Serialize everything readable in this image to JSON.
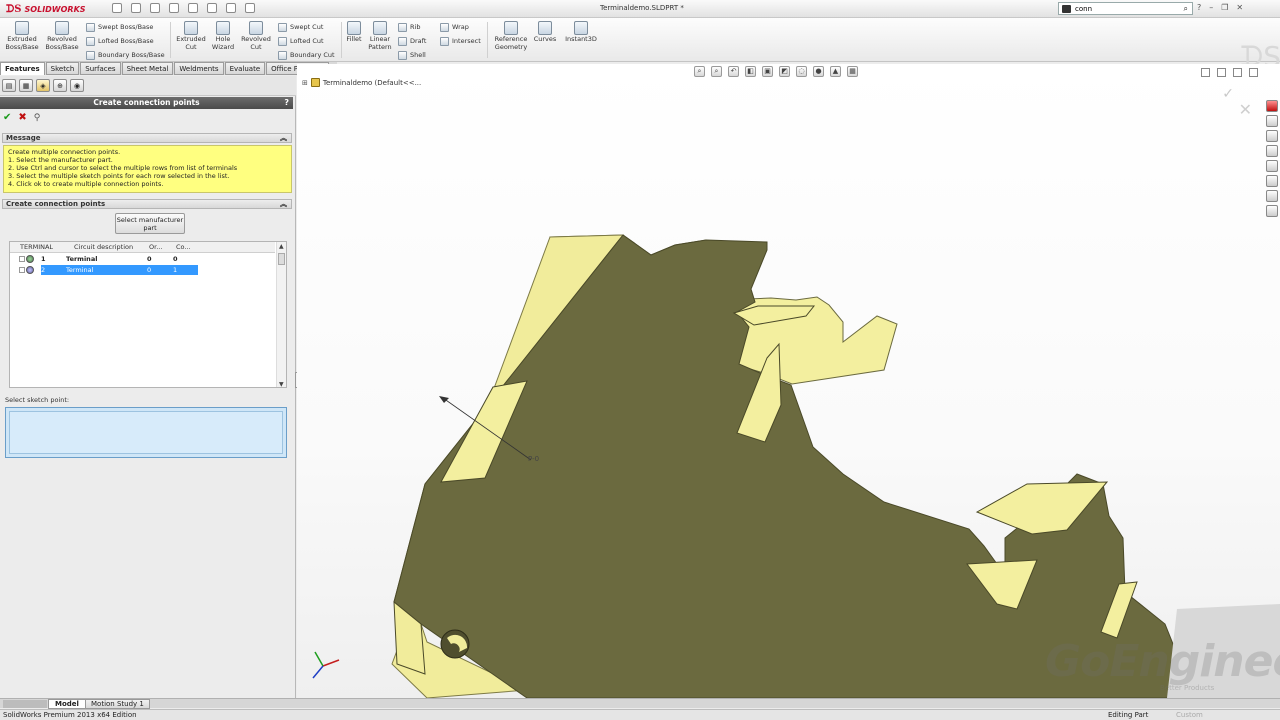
{
  "app": {
    "brand": "SOLIDWORKS",
    "document_title": "Terminaldemo.SLDPRT *"
  },
  "search": {
    "value": "conn"
  },
  "ribbon": {
    "extruded_boss": "Extruded Boss/Base",
    "revolved_boss": "Revolved Boss/Base",
    "swept_boss": "Swept Boss/Base",
    "lofted_boss": "Lofted Boss/Base",
    "boundary_boss": "Boundary Boss/Base",
    "extruded_cut": "Extruded Cut",
    "hole_wizard": "Hole Wizard",
    "revolved_cut": "Revolved Cut",
    "swept_cut": "Swept Cut",
    "lofted_cut": "Lofted Cut",
    "boundary_cut": "Boundary Cut",
    "fillet": "Fillet",
    "linear_pattern": "Linear Pattern",
    "rib": "Rib",
    "draft": "Draft",
    "shell": "Shell",
    "wrap": "Wrap",
    "intersect": "Intersect",
    "reference_geometry": "Reference Geometry",
    "curves": "Curves",
    "instant3d": "Instant3D"
  },
  "tabs": [
    "Features",
    "Sketch",
    "Surfaces",
    "Sheet Metal",
    "Weldments",
    "Evaluate",
    "Office Products"
  ],
  "property_manager": {
    "title": "Create connection points",
    "help": "?",
    "message_header": "Message",
    "message_lines": [
      "Create multiple connection points.",
      "1. Select the manufacturer part.",
      "2. Use Ctrl and cursor to select the multiple rows from list of terminals",
      "3. Select the multiple sketch points for each row selected in the list.",
      "4. Click ok to create multiple connection points."
    ],
    "group_header": "Create connection points",
    "select_mfr_button": "Select manufacturer part",
    "columns": [
      "TERMINAL",
      "Circuit description",
      "Or...",
      "Co..."
    ],
    "rows": [
      {
        "num": "1",
        "desc": "Terminal",
        "or": "0",
        "co": "0"
      },
      {
        "num": "2",
        "desc": "Terminal",
        "or": "0",
        "co": "1"
      }
    ],
    "sketch_point_label": "Select sketch point:"
  },
  "viewport": {
    "tree_root": "Terminaldemo  (Default<<...",
    "point_label": "P-0",
    "watermark": "GoEngineer",
    "watermark_sub": "Better Products"
  },
  "bottom_tabs": {
    "model": "Model",
    "motion": "Motion Study 1"
  },
  "status": {
    "app": "SolidWorks Premium 2013 x64 Edition",
    "mode": "Editing Part",
    "units": "Custom"
  },
  "colors": {
    "face": "#6b6a3f",
    "highlight": "#f3ef9f",
    "selection": "#3399ff",
    "message_bg": "#ffff80"
  }
}
